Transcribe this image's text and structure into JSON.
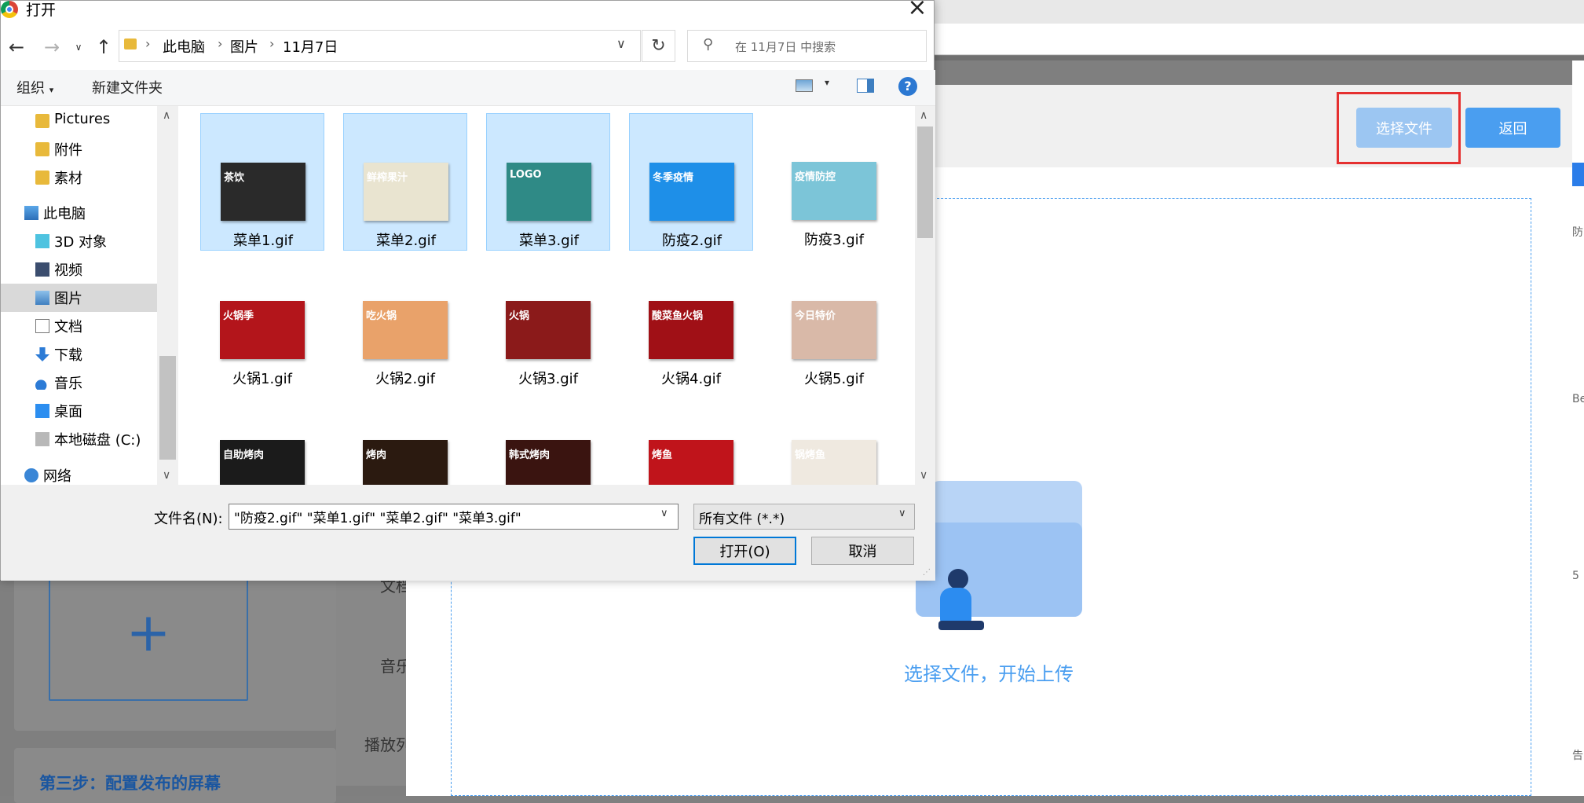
{
  "background_page": {
    "select_file_button": "选择文件",
    "back_button": "返回",
    "upload_prompt": "选择文件，开始上传",
    "step3_title": "第三步：配置发布的屏幕",
    "side_labels": [
      "文档",
      "音乐",
      "播放列"
    ],
    "right_edge_text": [
      "防",
      "Be",
      "5",
      "告"
    ],
    "plus_symbol": "+"
  },
  "dialog": {
    "title": "打开",
    "breadcrumb": [
      "此电脑",
      "图片",
      "11月7日"
    ],
    "search_placeholder": "在 11月7日 中搜索",
    "toolbar": {
      "organize": "组织",
      "new_folder": "新建文件夹",
      "help": "?"
    },
    "sidebar": [
      {
        "label": "Pictures",
        "icon": "folder-icon"
      },
      {
        "label": "附件",
        "icon": "folder-icon"
      },
      {
        "label": "素材",
        "icon": "folder-icon"
      },
      {
        "label": "此电脑",
        "icon": "computer-icon"
      },
      {
        "label": "3D 对象",
        "icon": "cube-icon"
      },
      {
        "label": "视频",
        "icon": "video-icon"
      },
      {
        "label": "图片",
        "icon": "picture-icon",
        "selected": true
      },
      {
        "label": "文档",
        "icon": "document-icon"
      },
      {
        "label": "下载",
        "icon": "download-icon"
      },
      {
        "label": "音乐",
        "icon": "music-icon"
      },
      {
        "label": "桌面",
        "icon": "desktop-icon"
      },
      {
        "label": "本地磁盘 (C:)",
        "icon": "drive-icon"
      },
      {
        "label": "网络",
        "icon": "network-icon"
      }
    ],
    "files": [
      {
        "name": "菜单1.gif",
        "selected": true,
        "thumb_text": "茶饮",
        "color": "#2a2a2a"
      },
      {
        "name": "菜单2.gif",
        "selected": true,
        "thumb_text": "鲜榨果汁",
        "color": "#e9e4d0"
      },
      {
        "name": "菜单3.gif",
        "selected": true,
        "thumb_text": "LOGO",
        "color": "#2f8a86"
      },
      {
        "name": "防疫2.gif",
        "selected": true,
        "thumb_text": "冬季疫情",
        "color": "#1e8fe8"
      },
      {
        "name": "防疫3.gif",
        "selected": false,
        "thumb_text": "疫情防控",
        "color": "#7cc5d8"
      },
      {
        "name": "火锅1.gif",
        "selected": false,
        "thumb_text": "火锅季",
        "color": "#b3151b"
      },
      {
        "name": "火锅2.gif",
        "selected": false,
        "thumb_text": "吃火锅",
        "color": "#e9a26a"
      },
      {
        "name": "火锅3.gif",
        "selected": false,
        "thumb_text": "火锅",
        "color": "#8b1a1a"
      },
      {
        "name": "火锅4.gif",
        "selected": false,
        "thumb_text": "酸菜鱼火锅",
        "color": "#a01016"
      },
      {
        "name": "火锅5.gif",
        "selected": false,
        "thumb_text": "今日特价",
        "color": "#d9b9a8"
      },
      {
        "name": "",
        "selected": false,
        "thumb_text": "自助烤肉",
        "color": "#1b1b1b"
      },
      {
        "name": "",
        "selected": false,
        "thumb_text": "烤肉",
        "color": "#2b1a10"
      },
      {
        "name": "",
        "selected": false,
        "thumb_text": "韩式烤肉",
        "color": "#3a1410"
      },
      {
        "name": "",
        "selected": false,
        "thumb_text": "烤鱼",
        "color": "#c0141b"
      },
      {
        "name": "",
        "selected": false,
        "thumb_text": "锅烤鱼",
        "color": "#efe9e0"
      }
    ],
    "filename_label": "文件名(N):",
    "filename_value": "\"防疫2.gif\" \"菜单1.gif\" \"菜单2.gif\" \"菜单3.gif\"",
    "filetype_value": "所有文件 (*.*)",
    "open_button": "打开(O)",
    "cancel_button": "取消"
  }
}
